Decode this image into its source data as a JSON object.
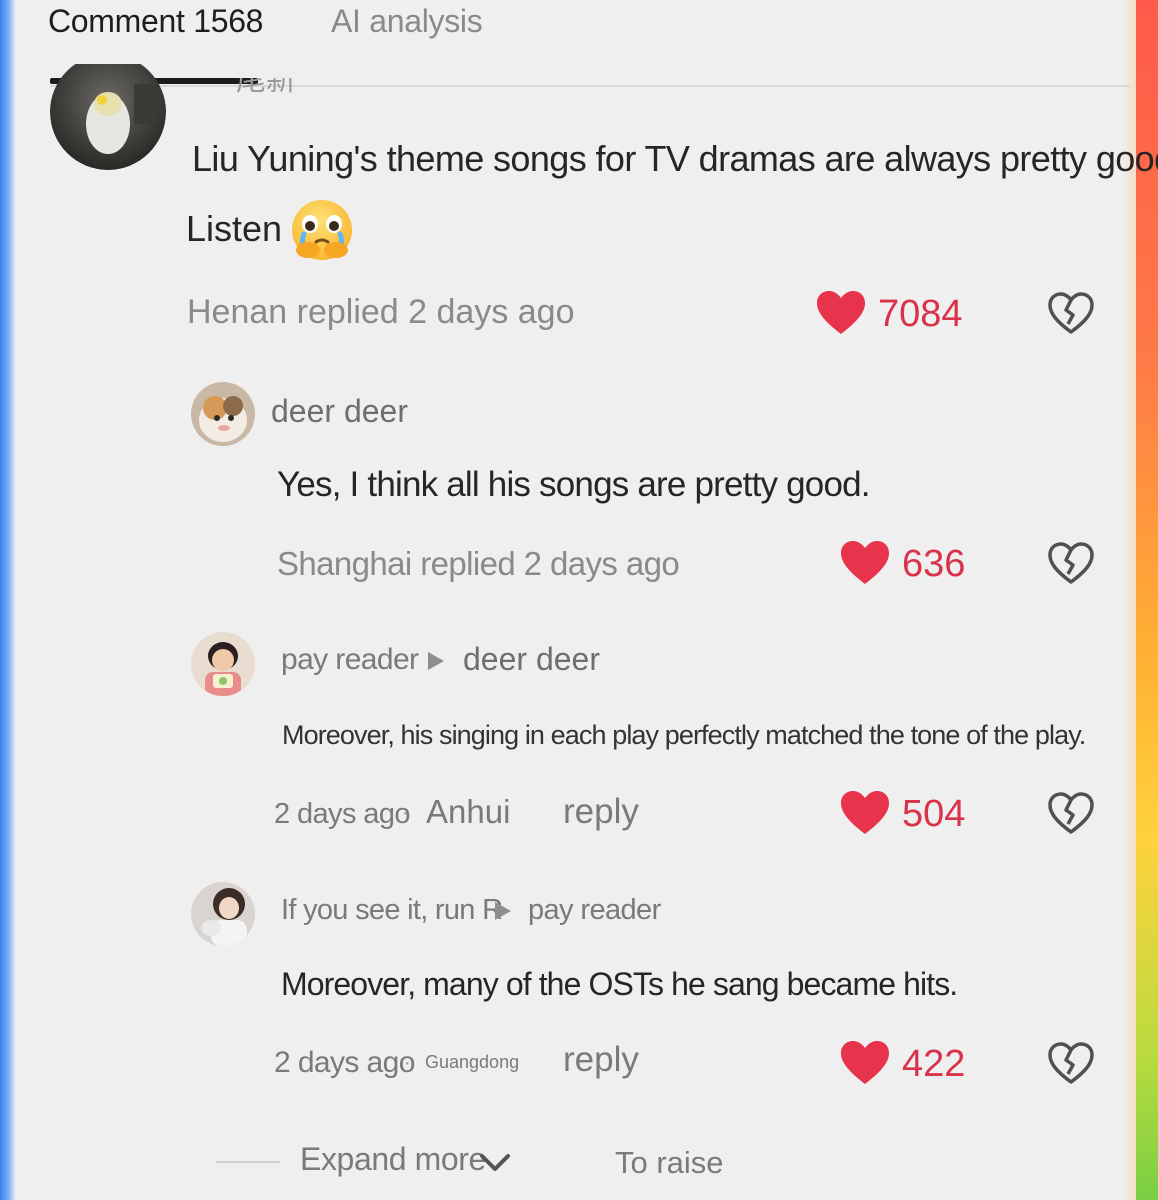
{
  "tabs": {
    "comments_label": "Comment 1568",
    "ai_label": "AI analysis"
  },
  "colors": {
    "like_red": "#e8334c",
    "text_dark": "#2b2b2b",
    "text_meta": "#8c8c8c"
  },
  "main_comment": {
    "cut_username": "尾新",
    "text_line1": "Liu Yuning's theme songs for TV dramas are always pretty good.",
    "text_line2": "Listen",
    "emoji": "🥹",
    "meta": "Henan replied 2 days ago",
    "likes": "7084"
  },
  "replies": [
    {
      "username": "deer deer",
      "text": "Yes, I think all his songs are pretty good.",
      "meta": "Shanghai replied 2 days ago",
      "likes": "636"
    },
    {
      "username": "pay reader",
      "reply_to": "deer deer",
      "text": "Moreover, his singing in each play perfectly matched the tone of the play.",
      "time": "2 days ago",
      "location": "Anhui",
      "reply_label": "reply",
      "likes": "504"
    },
    {
      "username": "If you see it, run R",
      "reply_to": "pay reader",
      "text": "Moreover, many of the OSTs he sang became hits.",
      "time": "2 days ago",
      "location": "Guangdong",
      "reply_label": "reply",
      "likes": "422"
    }
  ],
  "footer": {
    "expand_label": "Expand more",
    "raise_label": "To raise"
  },
  "icons": [
    "heart-icon",
    "broken-heart-icon",
    "triangle-arrow-icon",
    "chevron-down-icon"
  ]
}
